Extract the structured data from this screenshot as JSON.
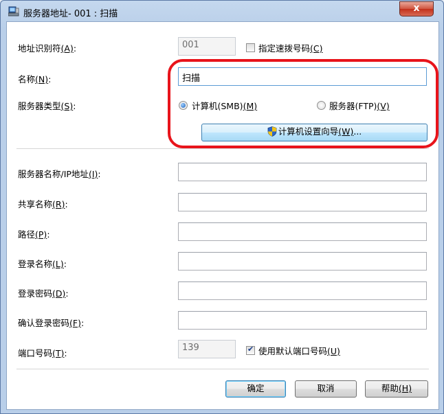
{
  "window": {
    "title": "服务器地址- 001 : 扫描",
    "close_label": "x"
  },
  "form": {
    "address_id": {
      "label": "地址识别符",
      "mnemonic": "(A)",
      "suffix": ":",
      "value": "001"
    },
    "speed_dial": {
      "label": "指定速拨号码",
      "mnemonic": "(C)",
      "checked": false
    },
    "name": {
      "label": "名称",
      "mnemonic": "(N)",
      "suffix": ":",
      "value": "扫描"
    },
    "server_type": {
      "label": "服务器类型",
      "mnemonic": "(S)",
      "suffix": ":",
      "options": [
        {
          "label": "计算机(SMB)",
          "mnemonic": "(M)",
          "selected": true
        },
        {
          "label": "服务器(FTP)",
          "mnemonic": "(V)",
          "selected": false
        }
      ]
    },
    "wizard_button": {
      "label": "计算机设置向导",
      "mnemonic": "(W)",
      "suffix": "..."
    },
    "server_name": {
      "label": "服务器名称/IP地址",
      "mnemonic": "(I)",
      "suffix": ":",
      "value": ""
    },
    "share_name": {
      "label": "共享名称",
      "mnemonic": "(R)",
      "suffix": ":",
      "value": ""
    },
    "path": {
      "label": "路径",
      "mnemonic": "(P)",
      "suffix": ":",
      "value": ""
    },
    "login_name": {
      "label": "登录名称",
      "mnemonic": "(L)",
      "suffix": ":",
      "value": ""
    },
    "login_password": {
      "label": "登录密码",
      "mnemonic": "(D)",
      "suffix": ":",
      "value": ""
    },
    "confirm_password": {
      "label": "确认登录密码",
      "mnemonic": "(F)",
      "suffix": ":",
      "value": ""
    },
    "port": {
      "label": "端口号码",
      "mnemonic": "(T)",
      "suffix": ":",
      "value": "139"
    },
    "default_port": {
      "label": "使用默认端口号码",
      "mnemonic": "(U)",
      "checked": true
    }
  },
  "buttons": {
    "ok": {
      "label": "确定"
    },
    "cancel": {
      "label": "取消"
    },
    "help": {
      "label": "帮助",
      "mnemonic": "(H)"
    }
  },
  "colors": {
    "highlight": "#e8141b",
    "accent": "#3c7fb1"
  }
}
